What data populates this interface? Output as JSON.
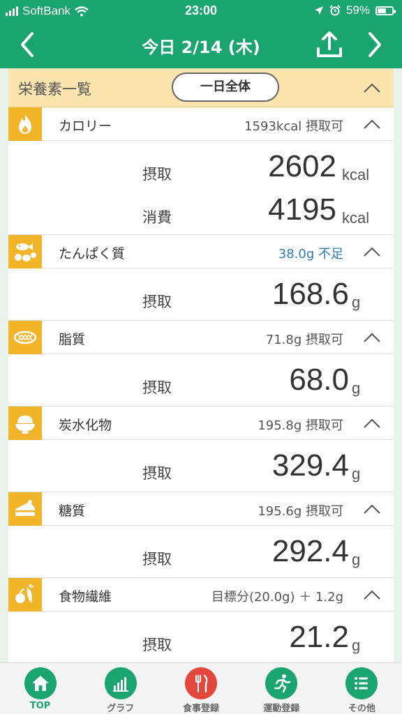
{
  "status_bar": {
    "carrier": "SoftBank",
    "time": "23:00",
    "battery": "59%"
  },
  "header": {
    "title": "今日 2/14 (木)"
  },
  "summary": {
    "label": "栄養素一覧",
    "filter_button": "一日全体"
  },
  "sections": [
    {
      "name": "カロリー",
      "status": "1593kcal 摂取可",
      "icon": "flame-icon",
      "rows": [
        {
          "label": "摂取",
          "value": "2602",
          "unit": "kcal"
        },
        {
          "label": "消費",
          "value": "4195",
          "unit": "kcal"
        }
      ]
    },
    {
      "name": "たんぱく質",
      "status": "38.0g 不足",
      "icon": "protein-food-icon",
      "rows": [
        {
          "label": "摂取",
          "value": "168.6",
          "unit": "g"
        }
      ]
    },
    {
      "name": "脂質",
      "status": "71.8g 摂取可",
      "icon": "fat-icon",
      "rows": [
        {
          "label": "摂取",
          "value": "68.0",
          "unit": "g"
        }
      ]
    },
    {
      "name": "炭水化物",
      "status": "195.8g 摂取可",
      "icon": "rice-bowl-icon",
      "rows": [
        {
          "label": "摂取",
          "value": "329.4",
          "unit": "g"
        }
      ]
    },
    {
      "name": "糖質",
      "status": "195.6g 摂取可",
      "icon": "cake-icon",
      "rows": [
        {
          "label": "摂取",
          "value": "292.4",
          "unit": "g"
        }
      ]
    },
    {
      "name": "食物繊維",
      "status": "目標分(20.0g) ＋ 1.2g",
      "icon": "vegetable-icon",
      "rows": [
        {
          "label": "摂取",
          "value": "21.2",
          "unit": "g"
        }
      ]
    }
  ],
  "tabs": [
    {
      "label": "TOP",
      "icon": "home-icon",
      "active": true
    },
    {
      "label": "グラフ",
      "icon": "bar-chart-icon"
    },
    {
      "label": "食事登録",
      "icon": "fork-knife-icon"
    },
    {
      "label": "運動登録",
      "icon": "running-icon"
    },
    {
      "label": "その他",
      "icon": "list-icon"
    }
  ],
  "colors": {
    "primary": "#1aa46f",
    "summary_bg": "#fbe4ad",
    "icon_bg": "#f2b429",
    "shortage": "#2f7db5",
    "meal_tab": "#e2483b"
  }
}
